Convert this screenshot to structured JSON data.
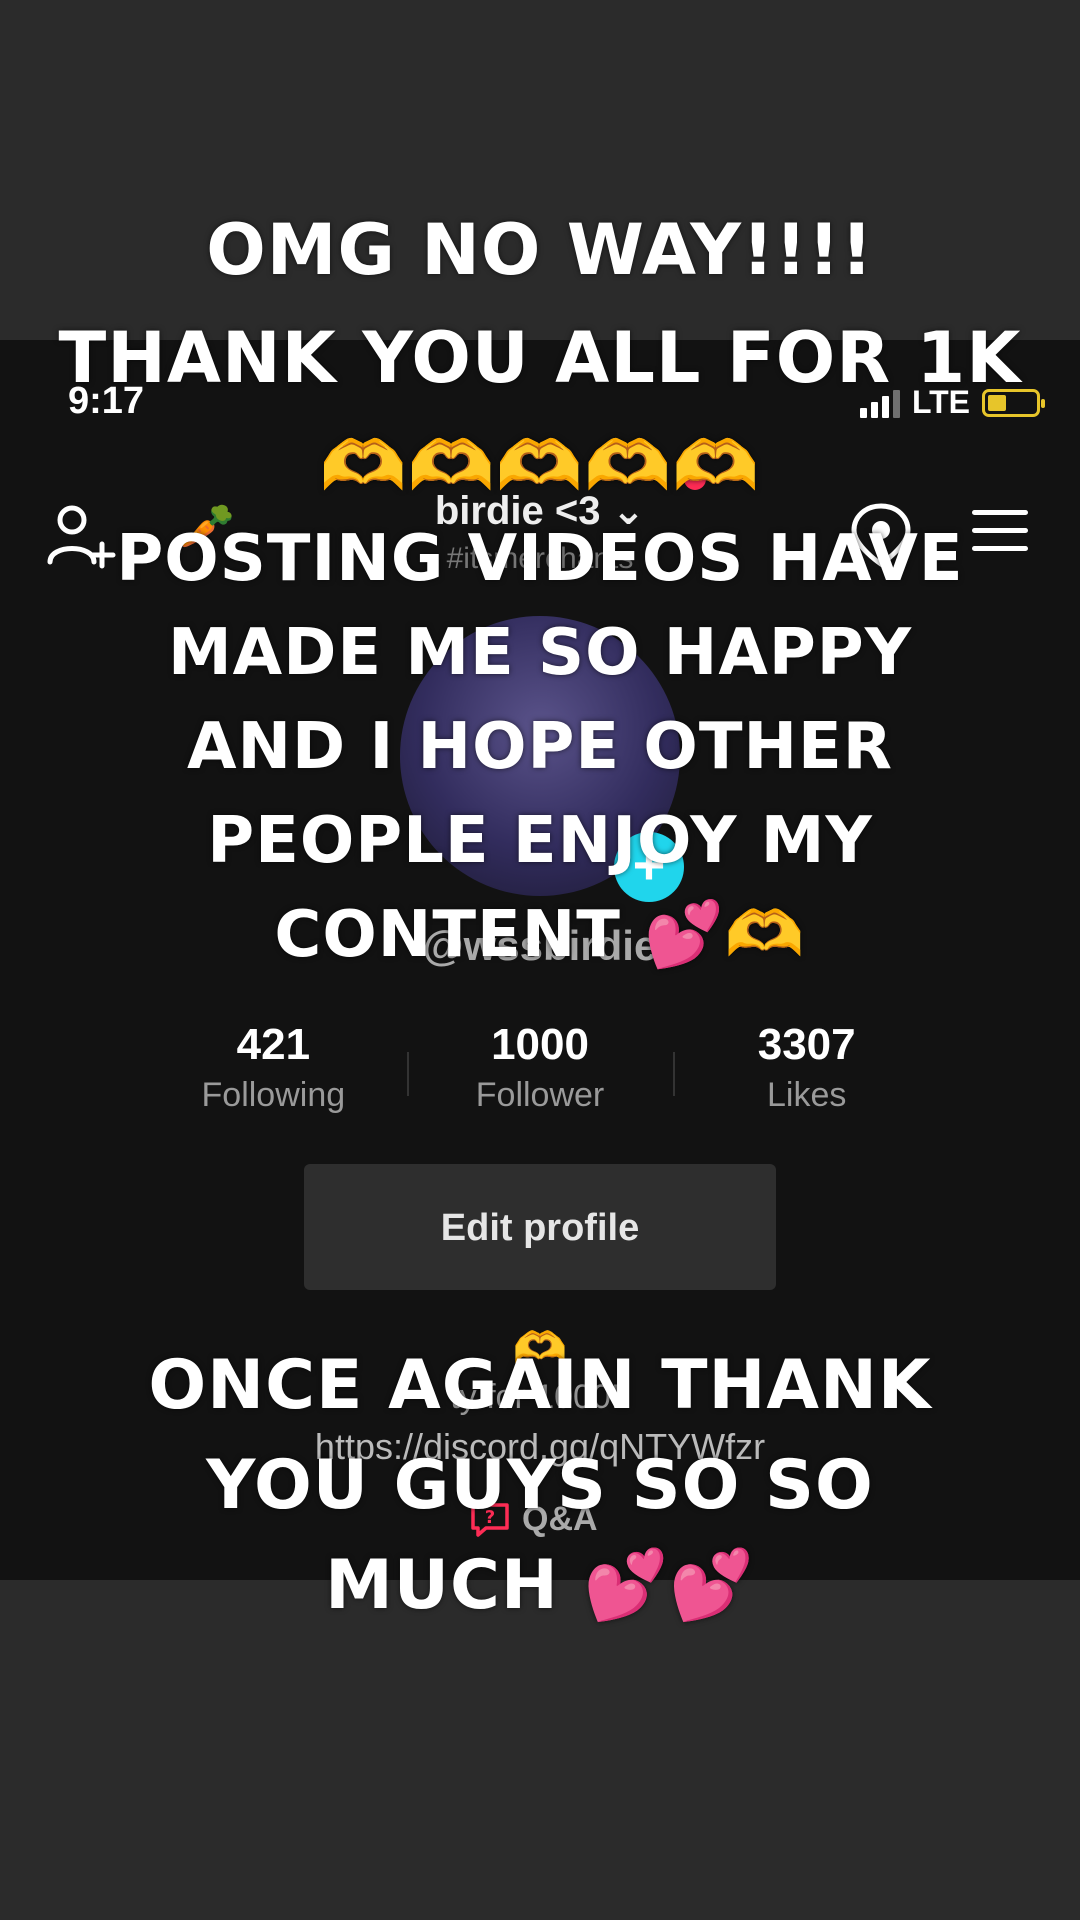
{
  "status_bar": {
    "time": "9:17",
    "network": "LTE"
  },
  "profile": {
    "display_name": "birdie <3",
    "subtitle": "#itsmerchants",
    "handle": "@wssbirdie",
    "stats": [
      {
        "value": "421",
        "label": "Following"
      },
      {
        "value": "1000",
        "label": "Follower"
      },
      {
        "value": "3307",
        "label": "Likes"
      }
    ],
    "edit_label": "Edit profile",
    "bio_emoji": "🫶",
    "bio_line": "ty for 1000!!",
    "bio_link": "https://discord.gg/qNTYWfzr",
    "qa_label": "Q&A",
    "carrot_emoji": "🥕"
  },
  "captions": {
    "top_line1": "OMG NO WAY!!!!",
    "top_line2": "THANK YOU ALL FOR 1K",
    "top_line3": "🫶🫶🫶🫶🫶",
    "mid_line1": "POSTING VIDEOS HAVE",
    "mid_line2": "MADE ME SO HAPPY",
    "mid_line3": "AND I HOPE OTHER",
    "mid_line4": "PEOPLE ENJOY MY",
    "mid_line5": "CONTENT 💕🫶",
    "bottom_line1": "ONCE AGAIN THANK",
    "bottom_line2": "YOU GUYS SO SO",
    "bottom_line3": "MUCH 💕💕"
  },
  "colors": {
    "accent_red": "#fe2c55",
    "accent_cyan": "#20d5ec",
    "battery": "#e7c52a"
  }
}
